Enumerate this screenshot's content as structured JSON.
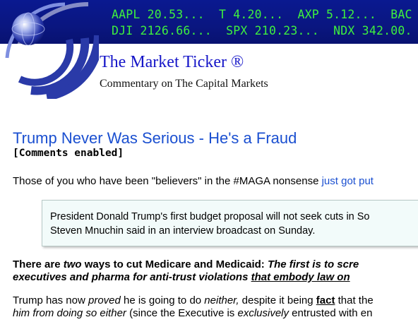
{
  "ticker": {
    "line1": "AAPL 20.53...  T 4.20...  AXP 5.12...  BAC",
    "line2": "DJI 2126.66...  SPX 210.23...  NDX 342.00."
  },
  "site": {
    "title": "The Market Ticker ®",
    "subtitle": "Commentary on The Capital Markets"
  },
  "article": {
    "title": "Trump Never Was Serious - He's a Fraud",
    "comments_tag": "[Comments enabled]",
    "intro_text": "Those of you who have been \"believers\" in the #MAGA nonsense ",
    "intro_link": "just got put",
    "quote_line1": "President Donald Trump's first budget proposal will not seek cuts in So",
    "quote_line2": "Steven Mnuchin said in an interview broadcast on Sunday.",
    "bold_a": "There are ",
    "bold_b": "two",
    "bold_c": " ways to cut Medicare and Medicaid: ",
    "bold_d": "The first is to scre",
    "bold_line2_a": "executives and pharma for anti-trust violations ",
    "bold_line2_b": "that embody law on",
    "last_a": "Trump has now ",
    "last_b": "proved",
    "last_c": " he is going to do ",
    "last_d": "neither,",
    "last_e": " despite it being ",
    "last_f": "fact",
    "last_g": " that the",
    "last_line2_a": "him from doing so either",
    "last_line2_b": " (since the Executive is ",
    "last_line2_c": "exclusively",
    "last_line2_d": " entrusted with en"
  },
  "colors": {
    "ticker_bg": "#0a1990",
    "ticker_text": "#3ef03e",
    "link": "#1a4fd0",
    "site_title": "#1515c8"
  },
  "icons": {
    "logo": "globe-arcs-logo-icon"
  }
}
